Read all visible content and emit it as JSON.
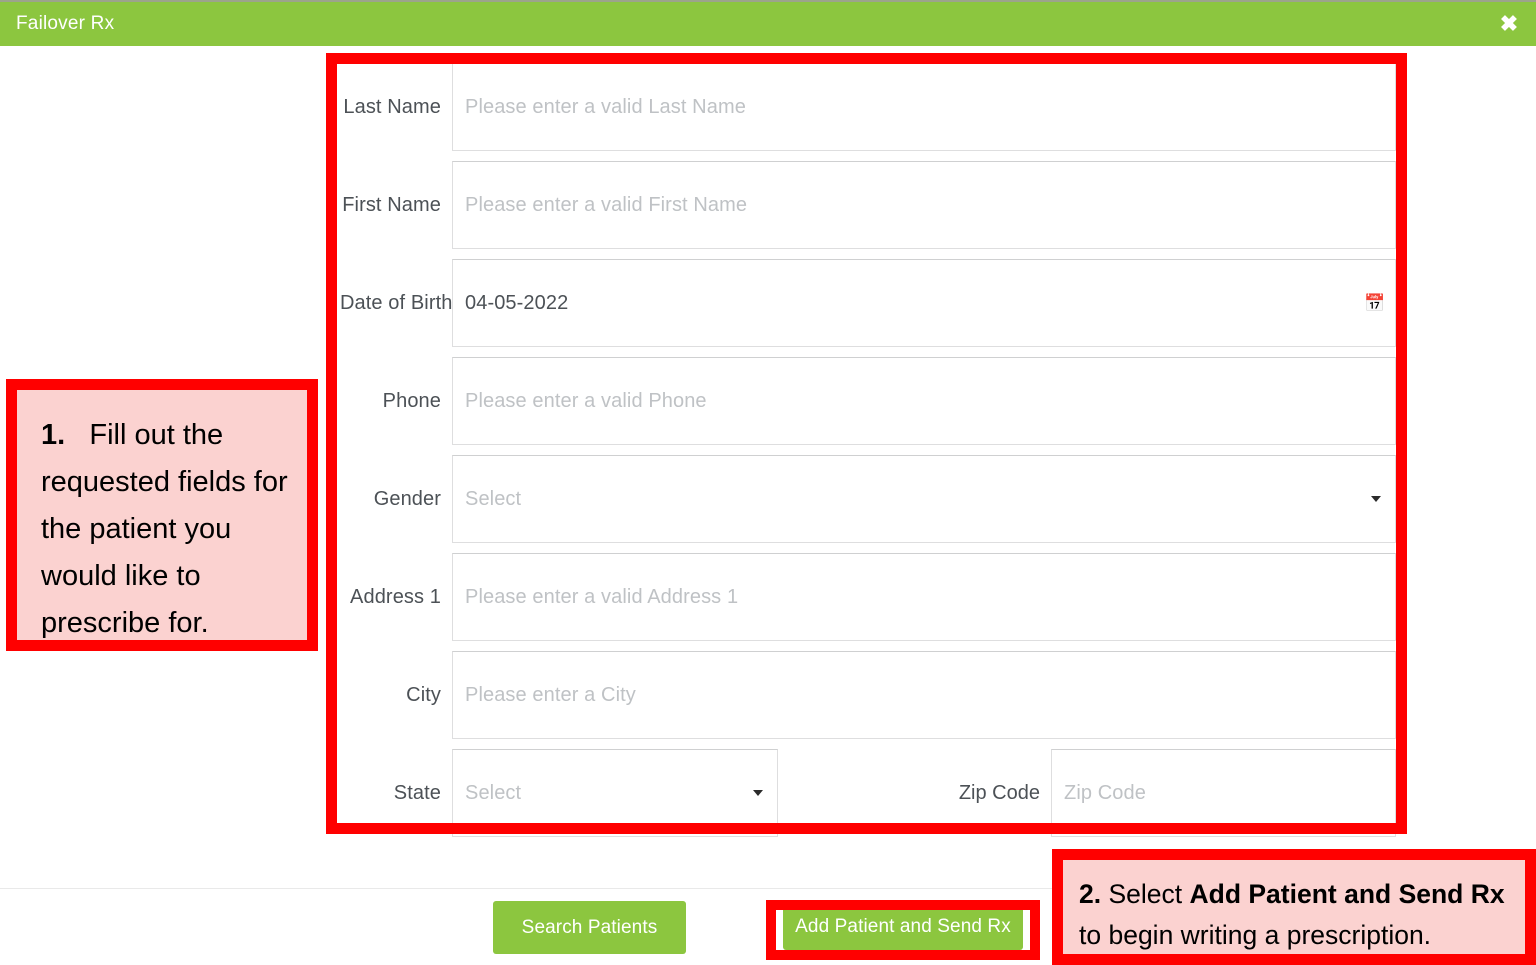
{
  "modal": {
    "title": "Failover Rx",
    "close_icon": "close-x-icon"
  },
  "form": {
    "fields": [
      {
        "label": "Last Name",
        "type": "text",
        "value": "",
        "placeholder": "Please enter a valid Last Name"
      },
      {
        "label": "First Name",
        "type": "text",
        "value": "",
        "placeholder": "Please enter a valid First Name"
      },
      {
        "label": "Date of Birth",
        "type": "date",
        "value": "04-05-2022",
        "placeholder": "",
        "icon": "calendar-icon"
      },
      {
        "label": "Phone",
        "type": "text",
        "value": "",
        "placeholder": "Please enter a valid Phone"
      },
      {
        "label": "Gender",
        "type": "select",
        "value": "",
        "placeholder": "Select",
        "icon": "chevron-down-icon"
      },
      {
        "label": "Address 1",
        "type": "text",
        "value": "",
        "placeholder": "Please enter a valid Address 1"
      },
      {
        "label": "City",
        "type": "text",
        "value": "",
        "placeholder": "Please enter a City"
      }
    ],
    "state": {
      "label": "State",
      "placeholder": "Select",
      "value": "",
      "icon": "chevron-down-icon"
    },
    "zip": {
      "label": "Zip Code",
      "placeholder": "Zip Code",
      "value": ""
    }
  },
  "footer": {
    "search_patients_label": "Search Patients",
    "add_patient_label": "Add Patient and Send Rx"
  },
  "annotations": {
    "step1": {
      "number": "1.",
      "text": "Fill out the requested fields for the patient you would like to prescribe for."
    },
    "step2": {
      "number": "2.",
      "lead": " Select ",
      "bold": "Add Patient and Send Rx",
      "tail": " to begin writing a prescription."
    }
  },
  "colors": {
    "brand_green": "#8CC63F",
    "annotation_red": "#FF0000",
    "annotation_fill": "#FBD2D0"
  }
}
